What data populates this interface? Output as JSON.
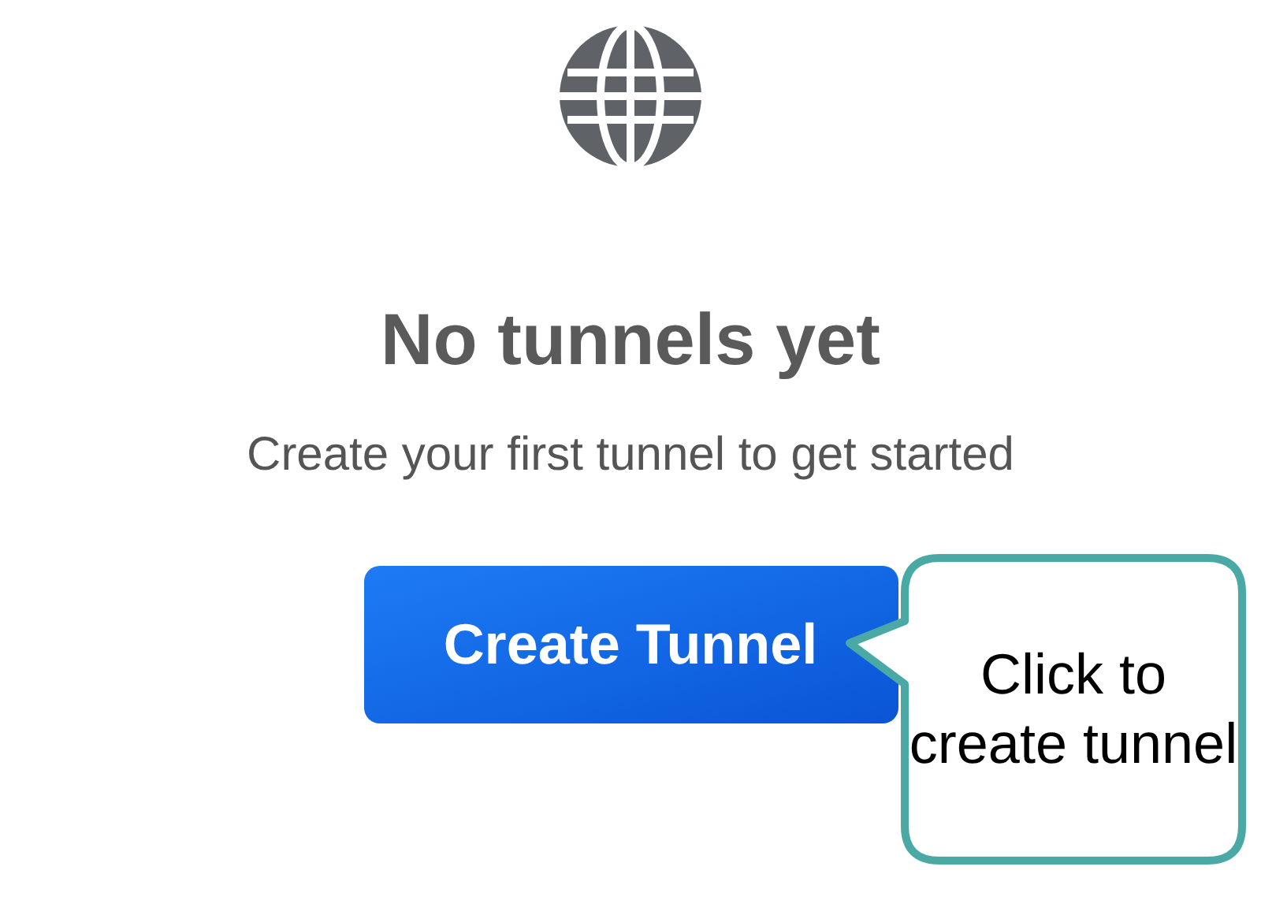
{
  "empty_state": {
    "title": "No tunnels yet",
    "message": "Create your first tunnel to get started",
    "button": "Create Tunnel"
  },
  "callout": {
    "text": "Click to create tunnel"
  }
}
